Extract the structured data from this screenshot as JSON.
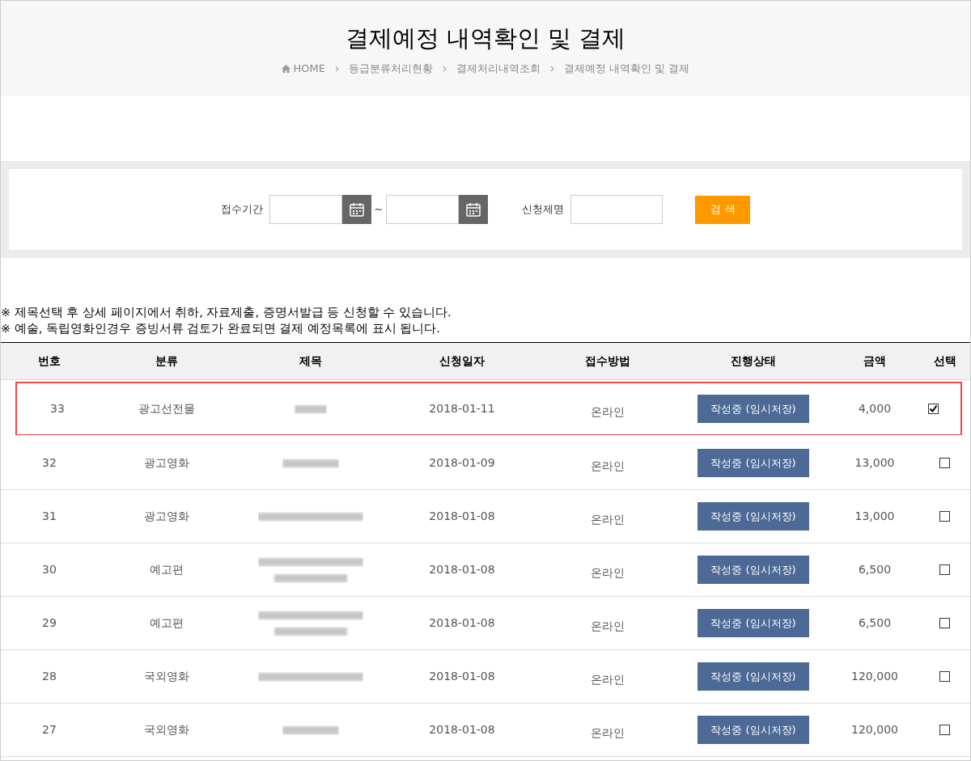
{
  "header": {
    "title": "결제예정 내역확인 및 결제",
    "breadcrumb": [
      "HOME",
      "등급분류처리현황",
      "결제처리내역조회",
      "결제예정 내역확인 및 결제"
    ]
  },
  "search": {
    "period_label": "접수기간",
    "separator": "~",
    "title_label": "신청제명",
    "button": "검 색"
  },
  "notes": [
    "※ 제목선택 후 상세 페이지에서 취하, 자료제출, 증명서발급 등 신청할 수 있습니다.",
    "※ 예술, 독립영화인경우 증빙서류 검토가 완료되면 결제 예정목록에 표시 됩니다."
  ],
  "table": {
    "columns": [
      "번호",
      "분류",
      "제목",
      "신청일자",
      "접수방법",
      "진행상태",
      "금액",
      "선택"
    ],
    "rows": [
      {
        "no": "33",
        "category": "광고선전물",
        "title": {
          "kind": "blurred_short"
        },
        "date": "2018-01-11",
        "method": "온라인",
        "status": "작성중 (임시저장)",
        "amount": "4,000",
        "checked": true,
        "highlighted": true
      },
      {
        "no": "32",
        "category": "광고영화",
        "title": {
          "kind": "blurred"
        },
        "date": "2018-01-09",
        "method": "온라인",
        "status": "작성중 (임시저장)",
        "amount": "13,000",
        "checked": false,
        "highlighted": false
      },
      {
        "no": "31",
        "category": "광고영화",
        "title": {
          "kind": "blurred_long"
        },
        "date": "2018-01-08",
        "method": "온라인",
        "status": "작성중 (임시저장)",
        "amount": "13,000",
        "checked": false,
        "highlighted": false
      },
      {
        "no": "30",
        "category": "예고편",
        "title": {
          "kind": "blurred_two_line"
        },
        "date": "2018-01-08",
        "method": "온라인",
        "status": "작성중 (임시저장)",
        "amount": "6,500",
        "checked": false,
        "highlighted": false
      },
      {
        "no": "29",
        "category": "예고편",
        "title": {
          "kind": "blurred_two_line"
        },
        "date": "2018-01-08",
        "method": "온라인",
        "status": "작성중 (임시저장)",
        "amount": "6,500",
        "checked": false,
        "highlighted": false
      },
      {
        "no": "28",
        "category": "국외영화",
        "title": {
          "kind": "blurred_long"
        },
        "date": "2018-01-08",
        "method": "온라인",
        "status": "작성중 (임시저장)",
        "amount": "120,000",
        "checked": false,
        "highlighted": false
      },
      {
        "no": "27",
        "category": "국외영화",
        "title": {
          "kind": "blurred"
        },
        "date": "2018-01-08",
        "method": "온라인",
        "status": "작성중 (임시저장)",
        "amount": "120,000",
        "checked": false,
        "highlighted": false
      }
    ]
  }
}
